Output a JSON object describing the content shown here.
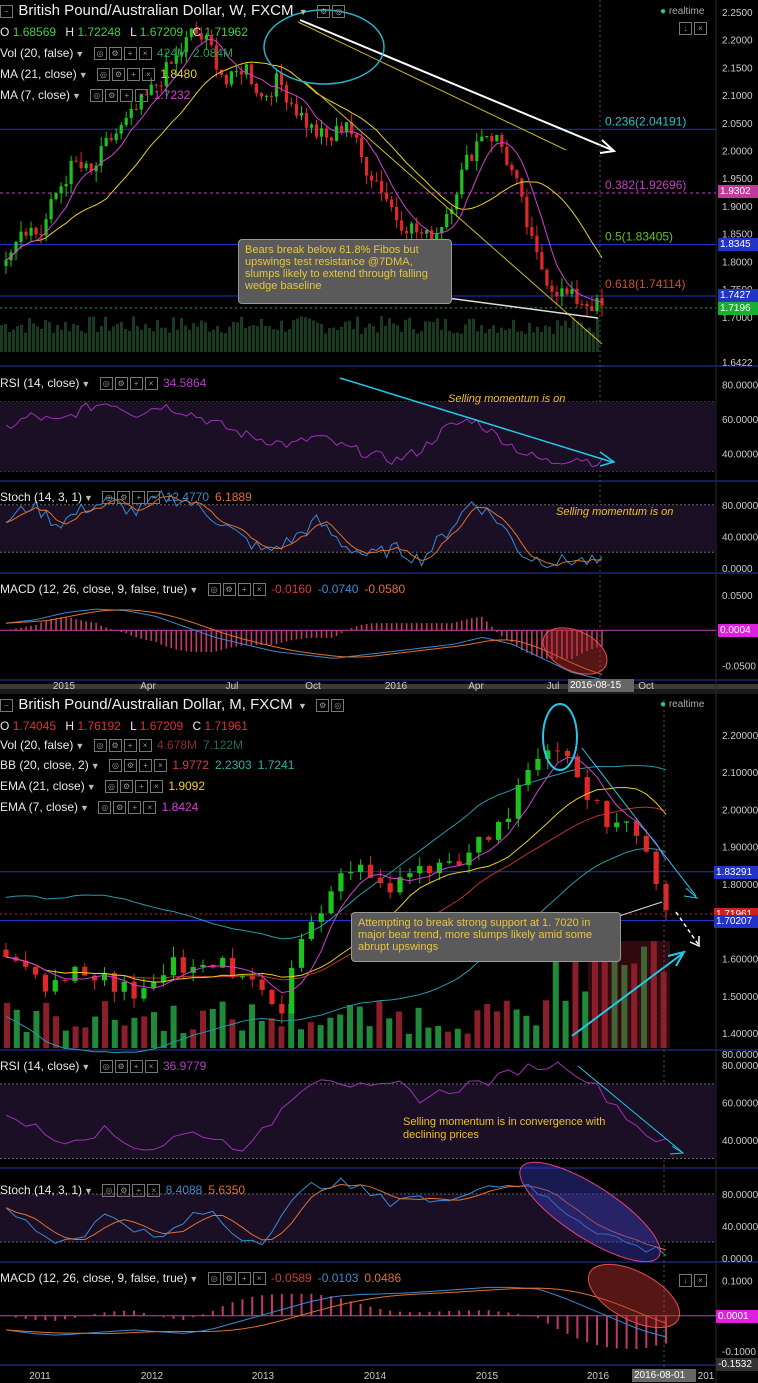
{
  "weekly": {
    "title": "British Pound/Australian Dollar, W, FXCM",
    "realtime": "realtime",
    "ohlc": {
      "o": "1.68569",
      "h": "1.72248",
      "l": "1.67209",
      "c": "1.71962"
    },
    "vol": {
      "label": "Vol (20, false)",
      "v1": "424M",
      "v2": "2.084M"
    },
    "ma21": {
      "label": "MA (21, close)",
      "value": "1.8480"
    },
    "ma7": {
      "label": "MA (7, close)",
      "value": "1.7232"
    },
    "note": "Bears break below 61.8% Fibos but upswings test resistance @7DMA, slumps likely to extend through falling wedge baseline",
    "fibs": [
      {
        "label": "0.236(2.04191)",
        "value": 2.04191,
        "color": "#22c8c8"
      },
      {
        "label": "0.382(1.92696)",
        "value": 1.92696,
        "color": "#c040c0"
      },
      {
        "label": "0.5(1.83405)",
        "value": 1.83405,
        "color": "#60c020"
      },
      {
        "label": "0.618(1.74114)",
        "value": 1.74114,
        "color": "#d05020"
      }
    ],
    "price_tags": [
      {
        "text": "1.9302",
        "bg": "#c03a9a"
      },
      {
        "text": "1.8345",
        "bg": "#2233c8"
      },
      {
        "text": "1.7427",
        "bg": "#2233c8"
      },
      {
        "text": "1.7196",
        "bg": "#18b030"
      }
    ],
    "price_ticks": [
      "2.2500",
      "2.2000",
      "2.1500",
      "2.1000",
      "2.0500",
      "2.0000",
      "1.9500",
      "1.9000",
      "1.8500",
      "1.8000",
      "1.7500",
      "1.7000",
      "1.6422"
    ],
    "rsi": {
      "label": "RSI (14, close)",
      "value": "34.5864",
      "ticks": [
        "80.0000",
        "60.0000",
        "40.0000"
      ],
      "note": "Selling momentum is on"
    },
    "stoch": {
      "label": "Stoch (14, 3, 1)",
      "k": "12.4770",
      "d": "6.1889",
      "ticks": [
        "80.0000",
        "40.0000",
        "0.0000"
      ],
      "note": "Selling momentum is on"
    },
    "macd": {
      "label": "MACD (12, 26, close, 9, false, true)",
      "v1": "-0.0160",
      "v2": "-0.0740",
      "v3": "-0.0580",
      "ticks": [
        "0.0500",
        "-0.0500"
      ],
      "tag": "0.0004"
    },
    "time_ticks": [
      "2015",
      "Apr",
      "Jul",
      "Oct",
      "2016",
      "Apr",
      "Jul",
      "Oct"
    ],
    "date_tag": "2016-08-15"
  },
  "monthly": {
    "title": "British Pound/Australian Dollar, M, FXCM",
    "realtime": "realtime",
    "ohlc": {
      "o": "1.74045",
      "h": "1.76192",
      "l": "1.67209",
      "c": "1.71961"
    },
    "vol": {
      "label": "Vol (20, false)",
      "v1": "4.678M",
      "v2": "7.122M"
    },
    "bb": {
      "label": "BB (20, close, 2)",
      "v1": "1.9772",
      "v2": "2.2303",
      "v3": "1.7241"
    },
    "ema21": {
      "label": "EMA (21, close)",
      "value": "1.9092"
    },
    "ema7": {
      "label": "EMA (7, close)",
      "value": "1.8424"
    },
    "note": "Attempting to break strong support at 1. 7020 in major bear trend, more slumps likely amid some abrupt upswings",
    "price_tags": [
      {
        "text": "1.83291",
        "bg": "#2233c8"
      },
      {
        "text": "1.71961",
        "bg": "#d02020"
      },
      {
        "text": "1.70207",
        "bg": "#2233c8"
      }
    ],
    "price_ticks": [
      "2.20000",
      "2.10000",
      "2.00000",
      "1.90000",
      "1.80000",
      "1.70000",
      "1.60000",
      "1.50000",
      "1.40000"
    ],
    "rsi": {
      "label": "RSI (14, close)",
      "value": "36.9779",
      "ticks": [
        "80.0000",
        "60.0000",
        "40.0000"
      ],
      "note": "Selling momentum is in convergence with declining prices"
    },
    "stoch": {
      "label": "Stoch (14, 3, 1)",
      "k": "8.4088",
      "d": "5.6350",
      "ticks": [
        "80.0000",
        "40.0000",
        "0.0000"
      ]
    },
    "macd": {
      "label": "MACD (12, 26, close, 9, false, true)",
      "v1": "-0.0589",
      "v2": "-0.0103",
      "v3": "0.0486",
      "ticks": [
        "0.1000",
        "0.0000",
        "-0.1000"
      ],
      "tag": "0.0001"
    },
    "time_ticks": [
      "2011",
      "2012",
      "2013",
      "2014",
      "2015",
      "2016",
      "201"
    ],
    "date_tag": "2016-08-01"
  },
  "chart_data": [
    {
      "type": "line",
      "title": "British Pound/Australian Dollar, W, FXCM",
      "x": [
        "2015",
        "Apr",
        "Jul",
        "Oct",
        "2016",
        "Apr",
        "Jul",
        "2016-08-15"
      ],
      "series": [
        {
          "name": "Close",
          "values": [
            1.8,
            1.91,
            2.1,
            2.14,
            2.06,
            1.86,
            1.76,
            1.72
          ]
        },
        {
          "name": "MA (21, close)",
          "values": [
            1.78,
            1.84,
            2.0,
            2.12,
            2.1,
            1.97,
            1.91,
            1.85
          ]
        },
        {
          "name": "MA (7, close)",
          "values": [
            1.82,
            1.9,
            2.08,
            2.16,
            2.07,
            1.88,
            1.8,
            1.72
          ]
        }
      ],
      "ylim": [
        1.64,
        2.25
      ],
      "fibonacci": [
        2.04191,
        1.92696,
        1.83405,
        1.74114
      ]
    },
    {
      "type": "line",
      "title": "British Pound/Australian Dollar, M, FXCM",
      "x": [
        "2011",
        "2012",
        "2013",
        "2014",
        "2015",
        "2016",
        "2016-08-01"
      ],
      "series": [
        {
          "name": "Close",
          "values": [
            1.58,
            1.53,
            1.6,
            1.85,
            1.95,
            2.03,
            1.72
          ]
        },
        {
          "name": "EMA (21, close)",
          "values": [
            1.62,
            1.56,
            1.55,
            1.72,
            1.88,
            1.98,
            1.91
          ]
        },
        {
          "name": "EMA (7, close)",
          "values": [
            1.6,
            1.54,
            1.58,
            1.82,
            1.98,
            2.0,
            1.84
          ]
        }
      ],
      "ylim": [
        1.36,
        2.24
      ]
    }
  ]
}
